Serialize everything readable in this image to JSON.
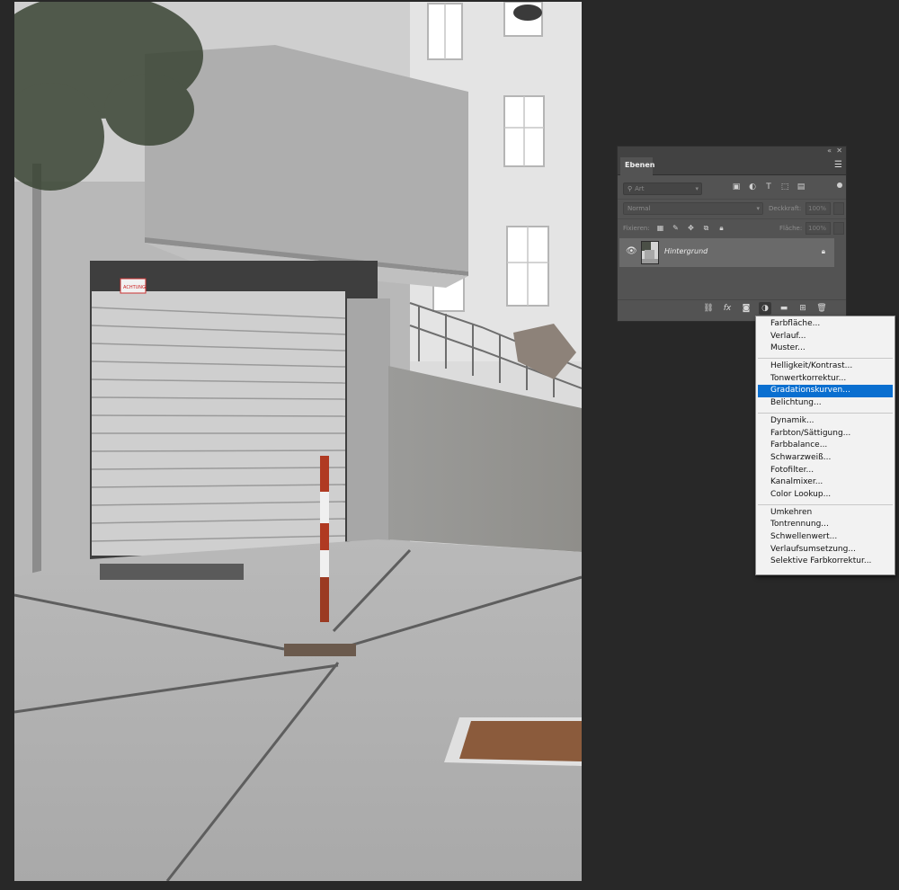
{
  "panel": {
    "tab_label": "Ebenen",
    "filter_placeholder": "Art",
    "blend_mode": "Normal",
    "opacity_label": "Deckkraft:",
    "opacity_value": "100%",
    "lock_label": "Fixieren:",
    "fill_label": "Fläche:",
    "fill_value": "100%",
    "layer": {
      "name": "Hintergrund"
    }
  },
  "menu": {
    "groups": [
      [
        "Farbfläche...",
        "Verlauf...",
        "Muster..."
      ],
      [
        "Helligkeit/Kontrast...",
        "Tonwertkorrektur...",
        "Gradationskurven...",
        "Belichtung..."
      ],
      [
        "Dynamik...",
        "Farbton/Sättigung...",
        "Farbbalance...",
        "Schwarzweiß...",
        "Fotofilter...",
        "Kanalmixer...",
        "Color Lookup..."
      ],
      [
        "Umkehren",
        "Tontrennung...",
        "Schwellenwert...",
        "Verlaufsumsetzung...",
        "Selektive Farbkorrektur..."
      ]
    ],
    "selected": "Gradationskurven..."
  },
  "photo": {
    "sign_text": "ACHTUNG"
  }
}
